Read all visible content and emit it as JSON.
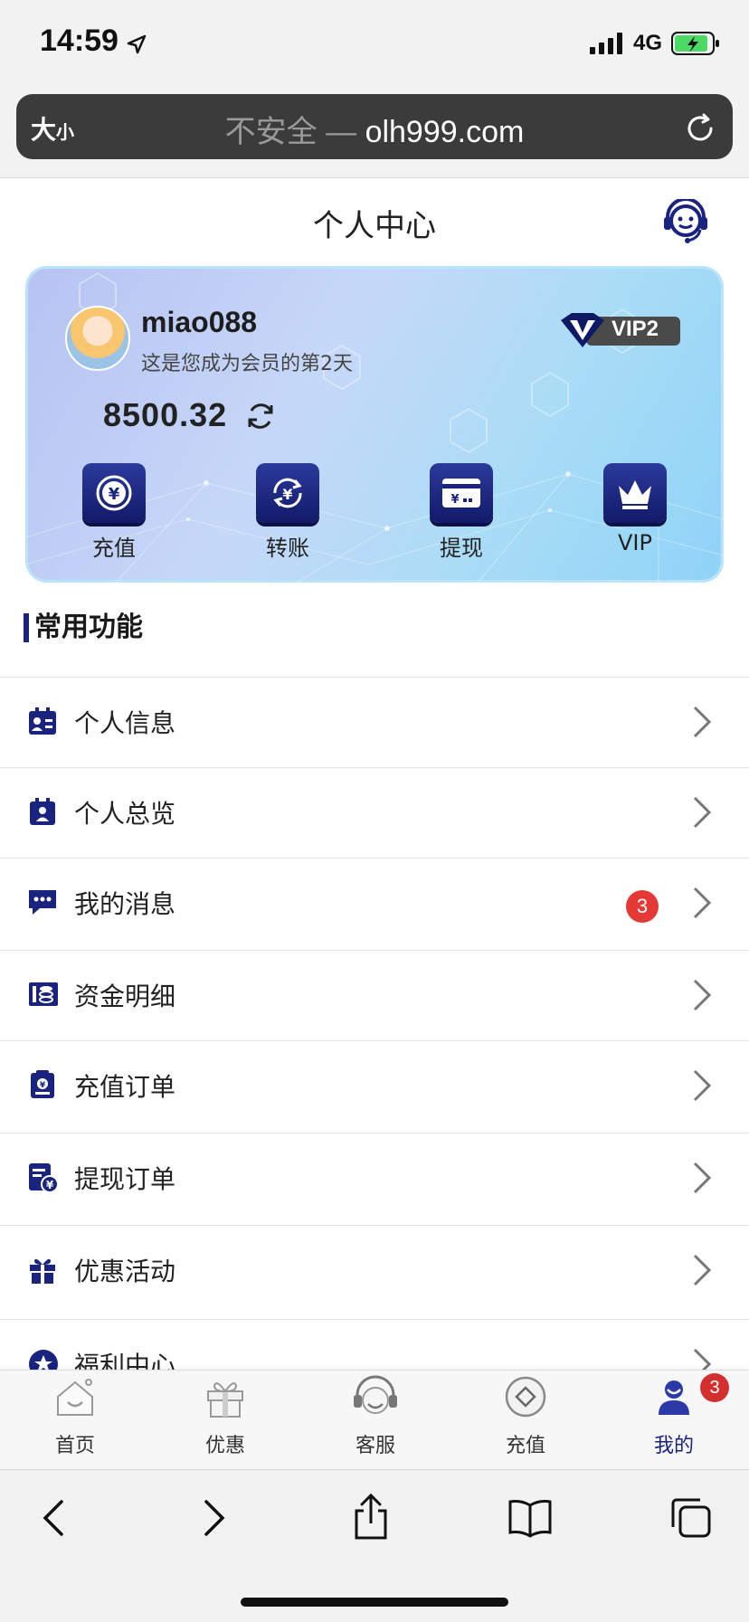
{
  "status_bar": {
    "time": "14:59",
    "network": "4G"
  },
  "browser": {
    "text_size_big": "大",
    "text_size_small": "小",
    "url_insecure": "不安全 —",
    "url_domain": "olh999.com"
  },
  "header": {
    "title": "个人中心"
  },
  "account": {
    "username": "miao088",
    "member_days_text": "这是您成为会员的第2天",
    "vip_level": "VIP2",
    "balance": "8500.32",
    "actions": [
      {
        "label": "充值",
        "icon": "yuan-coin-icon"
      },
      {
        "label": "转账",
        "icon": "transfer-icon"
      },
      {
        "label": "提现",
        "icon": "withdraw-card-icon"
      },
      {
        "label": "VIP",
        "icon": "crown-icon"
      }
    ]
  },
  "section": {
    "title": "常用功能"
  },
  "menu": [
    {
      "label": "个人信息",
      "icon": "id-card-icon"
    },
    {
      "label": "个人总览",
      "icon": "overview-icon"
    },
    {
      "label": "我的消息",
      "icon": "message-icon",
      "badge": "3"
    },
    {
      "label": "资金明细",
      "icon": "funds-icon"
    },
    {
      "label": "充值订单",
      "icon": "deposit-order-icon"
    },
    {
      "label": "提现订单",
      "icon": "withdraw-order-icon"
    },
    {
      "label": "优惠活动",
      "icon": "gift-icon"
    },
    {
      "label": "福利中心",
      "icon": "welfare-icon"
    }
  ],
  "tabbar": {
    "tabs": [
      {
        "label": "首页",
        "icon": "home-icon"
      },
      {
        "label": "优惠",
        "icon": "gift-icon"
      },
      {
        "label": "客服",
        "icon": "headset-icon"
      },
      {
        "label": "充值",
        "icon": "diamond-coin-icon"
      },
      {
        "label": "我的",
        "icon": "user-icon",
        "active": true
      }
    ],
    "mine_badge": "3"
  },
  "colors": {
    "accent": "#1a237e",
    "badge": "#e53935"
  }
}
